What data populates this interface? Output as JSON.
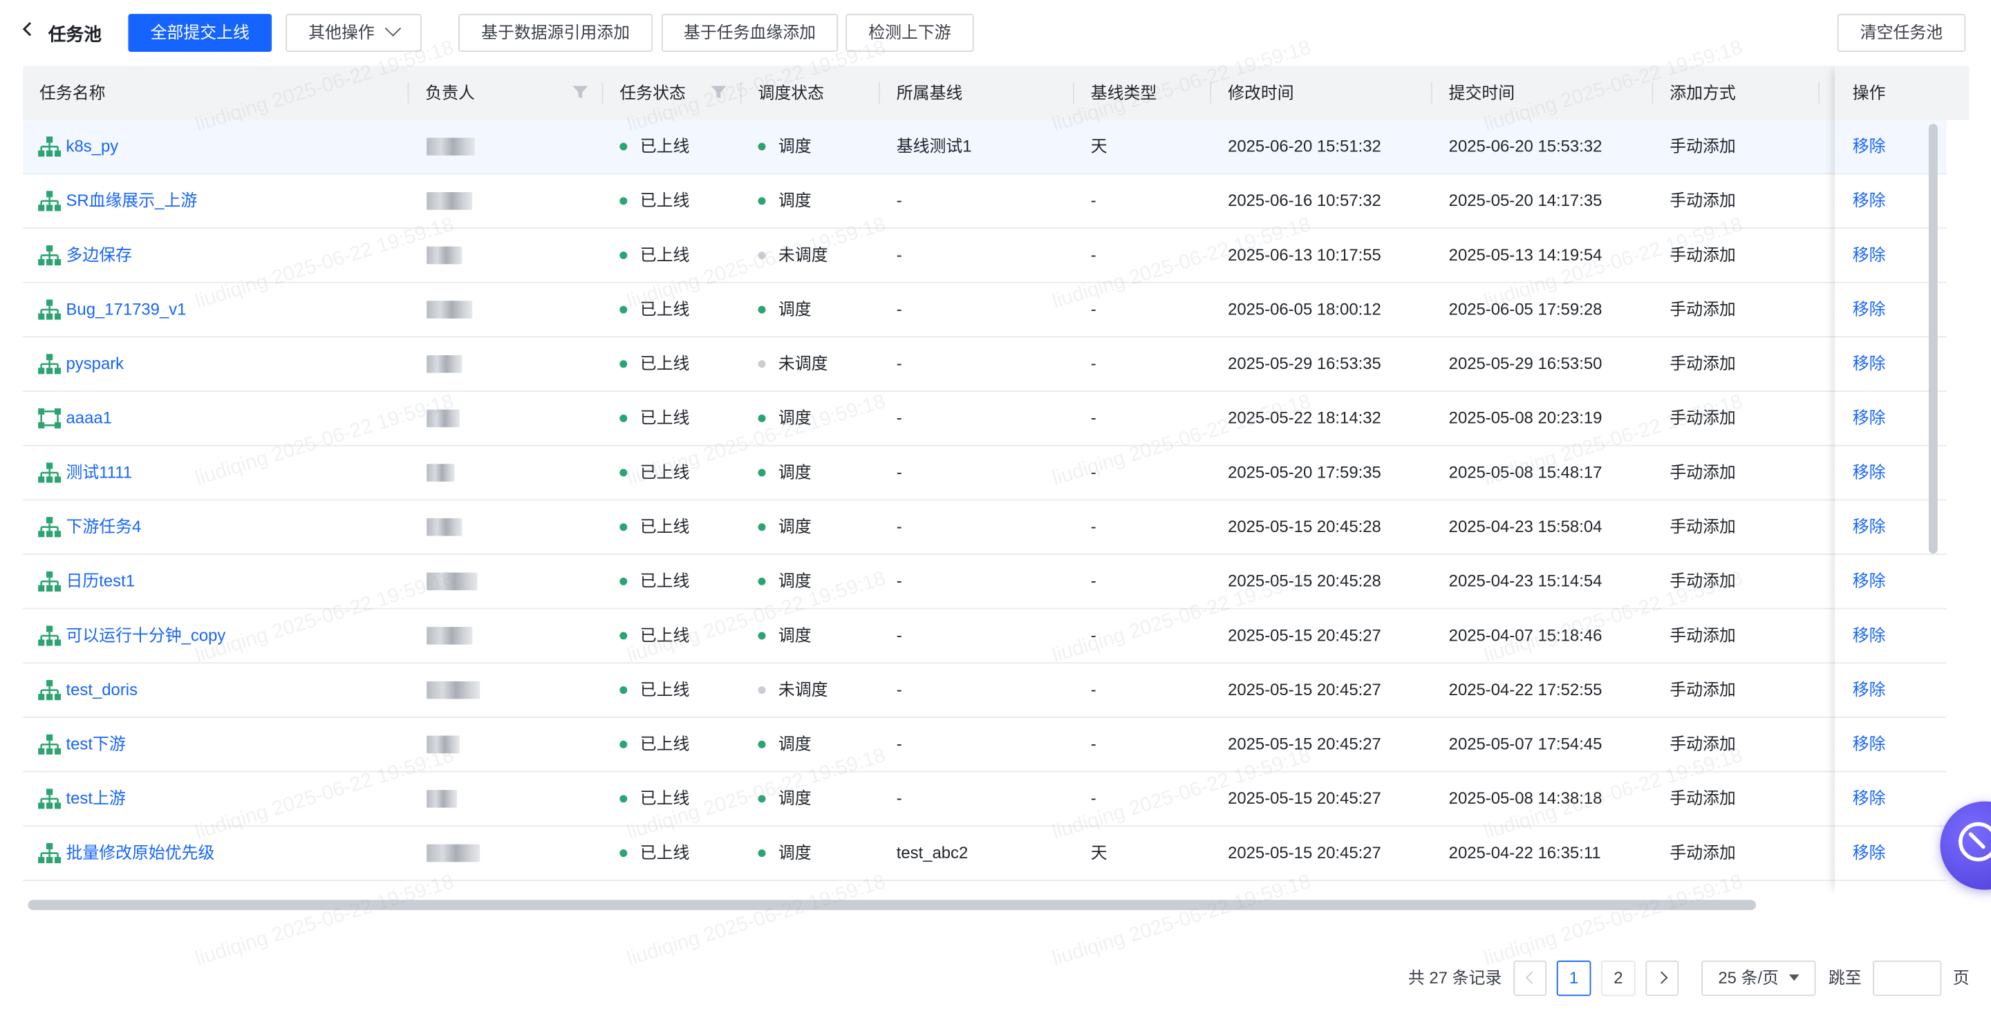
{
  "header": {
    "title": "任务池",
    "buttons": {
      "submit_all": "全部提交上线",
      "other_ops": "其他操作",
      "add_by_datasource": "基于数据源引用添加",
      "add_by_lineage": "基于任务血缘添加",
      "detect": "检测上下游",
      "clear_pool": "清空任务池"
    }
  },
  "table": {
    "columns": {
      "name": "任务名称",
      "owner": "负责人",
      "task_status": "任务状态",
      "schedule_status": "调度状态",
      "baseline": "所属基线",
      "baseline_type": "基线类型",
      "modified": "修改时间",
      "submitted": "提交时间",
      "add_method": "添加方式",
      "operation": "操作"
    },
    "rows": [
      {
        "name": "k8s_py",
        "task_status": "已上线",
        "schedule_status": "调度",
        "baseline": "基线测试1",
        "baseline_type": "天",
        "modified": "2025-06-20 15:51:32",
        "submitted": "2025-06-20 15:53:32",
        "add_method": "手动添加",
        "action": "移除"
      },
      {
        "name": "SR血缘展示_上游",
        "task_status": "已上线",
        "schedule_status": "调度",
        "baseline": "-",
        "baseline_type": "-",
        "modified": "2025-06-16 10:57:32",
        "submitted": "2025-05-20 14:17:35",
        "add_method": "手动添加",
        "action": "移除"
      },
      {
        "name": "多边保存",
        "task_status": "已上线",
        "schedule_status": "未调度",
        "baseline": "-",
        "baseline_type": "-",
        "modified": "2025-06-13 10:17:55",
        "submitted": "2025-05-13 14:19:54",
        "add_method": "手动添加",
        "action": "移除"
      },
      {
        "name": "Bug_171739_v1",
        "task_status": "已上线",
        "schedule_status": "调度",
        "baseline": "-",
        "baseline_type": "-",
        "modified": "2025-06-05 18:00:12",
        "submitted": "2025-06-05 17:59:28",
        "add_method": "手动添加",
        "action": "移除"
      },
      {
        "name": "pyspark",
        "task_status": "已上线",
        "schedule_status": "未调度",
        "baseline": "-",
        "baseline_type": "-",
        "modified": "2025-05-29 16:53:35",
        "submitted": "2025-05-29 16:53:50",
        "add_method": "手动添加",
        "action": "移除"
      },
      {
        "name": "aaaa1",
        "task_status": "已上线",
        "schedule_status": "调度",
        "baseline": "-",
        "baseline_type": "-",
        "modified": "2025-05-22 18:14:32",
        "submitted": "2025-05-08 20:23:19",
        "add_method": "手动添加",
        "action": "移除"
      },
      {
        "name": "测试1111",
        "task_status": "已上线",
        "schedule_status": "调度",
        "baseline": "-",
        "baseline_type": "-",
        "modified": "2025-05-20 17:59:35",
        "submitted": "2025-05-08 15:48:17",
        "add_method": "手动添加",
        "action": "移除"
      },
      {
        "name": "下游任务4",
        "task_status": "已上线",
        "schedule_status": "调度",
        "baseline": "-",
        "baseline_type": "-",
        "modified": "2025-05-15 20:45:28",
        "submitted": "2025-04-23 15:58:04",
        "add_method": "手动添加",
        "action": "移除"
      },
      {
        "name": "日历test1",
        "task_status": "已上线",
        "schedule_status": "调度",
        "baseline": "-",
        "baseline_type": "-",
        "modified": "2025-05-15 20:45:28",
        "submitted": "2025-04-23 15:14:54",
        "add_method": "手动添加",
        "action": "移除"
      },
      {
        "name": "可以运行十分钟_copy",
        "task_status": "已上线",
        "schedule_status": "调度",
        "baseline": "-",
        "baseline_type": "-",
        "modified": "2025-05-15 20:45:27",
        "submitted": "2025-04-07 15:18:46",
        "add_method": "手动添加",
        "action": "移除"
      },
      {
        "name": "test_doris",
        "task_status": "已上线",
        "schedule_status": "未调度",
        "baseline": "-",
        "baseline_type": "-",
        "modified": "2025-05-15 20:45:27",
        "submitted": "2025-04-22 17:52:55",
        "add_method": "手动添加",
        "action": "移除"
      },
      {
        "name": "test下游",
        "task_status": "已上线",
        "schedule_status": "调度",
        "baseline": "-",
        "baseline_type": "-",
        "modified": "2025-05-15 20:45:27",
        "submitted": "2025-05-07 17:54:45",
        "add_method": "手动添加",
        "action": "移除"
      },
      {
        "name": "test上游",
        "task_status": "已上线",
        "schedule_status": "调度",
        "baseline": "-",
        "baseline_type": "-",
        "modified": "2025-05-15 20:45:27",
        "submitted": "2025-05-08 14:38:18",
        "add_method": "手动添加",
        "action": "移除"
      },
      {
        "name": "批量修改原始优先级",
        "task_status": "已上线",
        "schedule_status": "调度",
        "baseline": "test_abc2",
        "baseline_type": "天",
        "modified": "2025-05-15 20:45:27",
        "submitted": "2025-04-22 16:35:11",
        "add_method": "手动添加",
        "action": "移除"
      }
    ]
  },
  "pagination": {
    "total": "共 27 条记录",
    "pages": [
      "1",
      "2"
    ],
    "current": "1",
    "page_size": "25 条/页",
    "jump_label": "跳至",
    "page_suffix": "页"
  },
  "watermark": "liudiqing 2025-06-22 19:59:18",
  "colors": {
    "primary": "#1664ff",
    "online_dot": "#2ba471",
    "scheduled_dot": "#2ba471",
    "unscheduled_dot": "#c9cdd4",
    "task_icon": "#2ba471"
  },
  "icons": {
    "back": "chevron-left-icon",
    "filter": "filter-icon",
    "task": "workflow-tree-icon",
    "float": "assistant-icon"
  }
}
